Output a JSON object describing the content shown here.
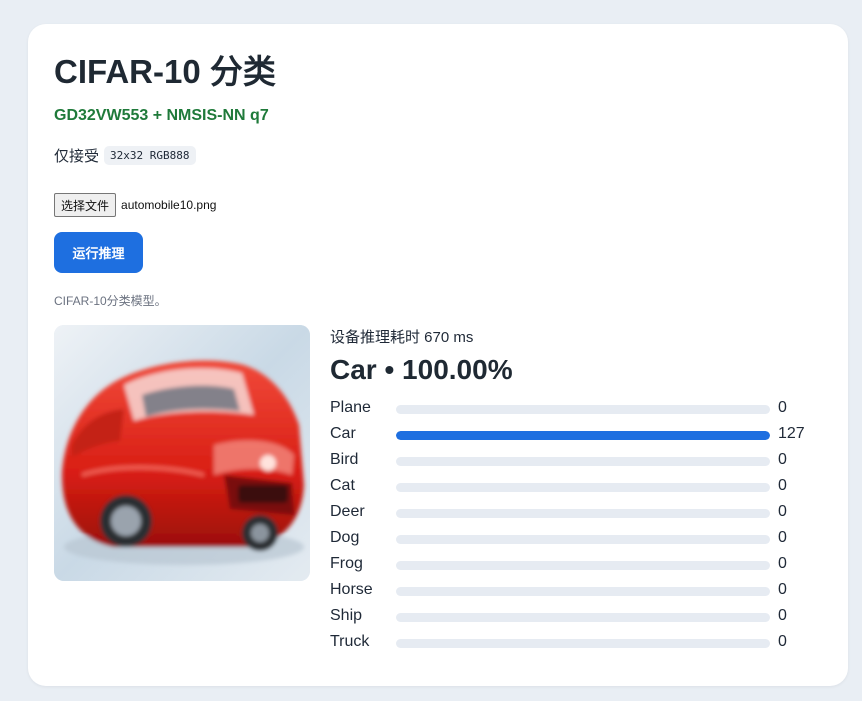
{
  "colors": {
    "page_background": "#e9eef4",
    "card_background": "#ffffff",
    "accent": "#1e6fe0",
    "subtitle": "#1f7a3a",
    "bar_track": "#e6ebf2"
  },
  "header": {
    "title": "CIFAR-10 分类",
    "subtitle": "GD32VW553 + NMSIS-NN q7"
  },
  "input_spec": {
    "label": "仅接受",
    "format": "32x32 RGB888"
  },
  "file_picker": {
    "button_label": "选择文件",
    "file_name": "automobile10.png"
  },
  "run_button": {
    "label": "运行推理"
  },
  "description": "CIFAR-10分类模型。",
  "preview": {
    "icon": "car-image"
  },
  "result": {
    "latency": "设备推理耗时 670 ms",
    "top_prediction": "Car • 100.00%",
    "max_score": 127,
    "classes": [
      {
        "label": "Plane",
        "value": "0",
        "score": 0
      },
      {
        "label": "Car",
        "value": "127",
        "score": 127
      },
      {
        "label": "Bird",
        "value": "0",
        "score": 0
      },
      {
        "label": "Cat",
        "value": "0",
        "score": 0
      },
      {
        "label": "Deer",
        "value": "0",
        "score": 0
      },
      {
        "label": "Dog",
        "value": "0",
        "score": 0
      },
      {
        "label": "Frog",
        "value": "0",
        "score": 0
      },
      {
        "label": "Horse",
        "value": "0",
        "score": 0
      },
      {
        "label": "Ship",
        "value": "0",
        "score": 0
      },
      {
        "label": "Truck",
        "value": "0",
        "score": 0
      }
    ]
  }
}
